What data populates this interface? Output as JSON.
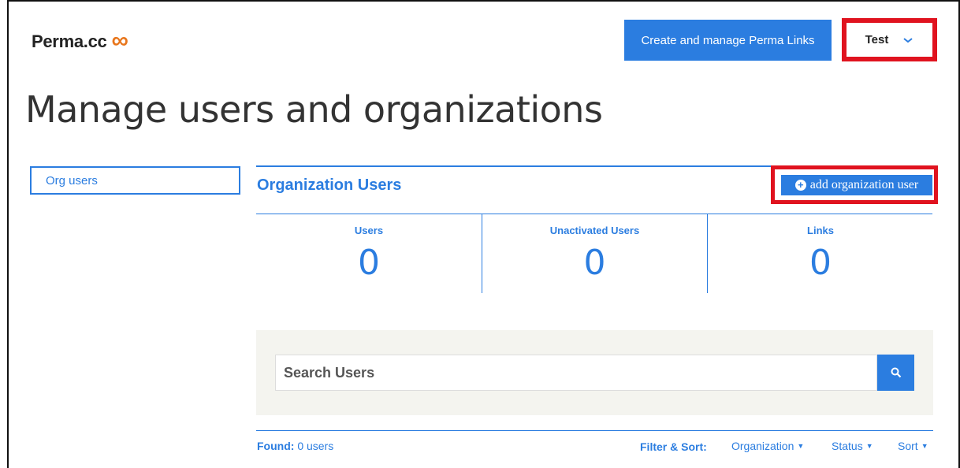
{
  "header": {
    "logo_text": "Perma.cc",
    "logo_symbol": "∞",
    "create_button": "Create and manage Perma Links",
    "user_name": "Test"
  },
  "page_title": "Manage users and organizations",
  "sidebar": {
    "items": [
      {
        "label": "Org users"
      }
    ]
  },
  "section": {
    "title": "Organization Users",
    "add_button": "add organization user"
  },
  "stats": [
    {
      "label": "Users",
      "value": "0"
    },
    {
      "label": "Unactivated Users",
      "value": "0"
    },
    {
      "label": "Links",
      "value": "0"
    }
  ],
  "search": {
    "placeholder": "Search Users"
  },
  "results": {
    "found_label": "Found:",
    "found_value": "0 users",
    "filter_label": "Filter & Sort:",
    "filters": [
      {
        "label": "Organization"
      },
      {
        "label": "Status"
      },
      {
        "label": "Sort"
      }
    ]
  },
  "colors": {
    "accent": "#2b7de0",
    "highlight": "#e0131f",
    "logo_symbol": "#e8761c",
    "search_bg": "#f4f4ef"
  }
}
